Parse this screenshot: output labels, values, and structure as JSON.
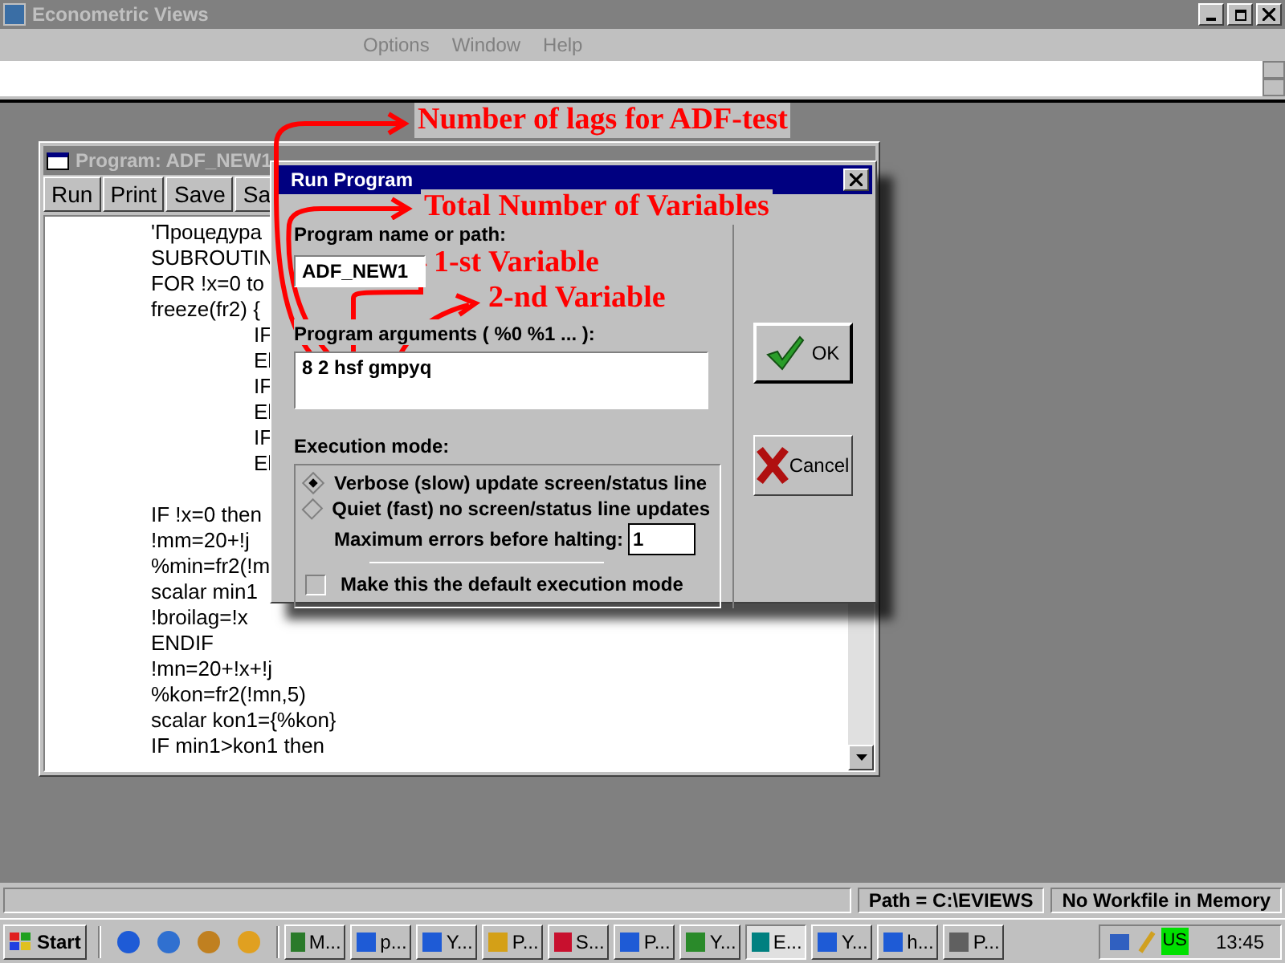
{
  "app_window": {
    "title": "Econometric Views",
    "menu": [
      "Options",
      "Window",
      "Help"
    ]
  },
  "program_window": {
    "title": "Program: ADF_NEW1",
    "toolbar": [
      "Run",
      "Print",
      "Save",
      "Sa"
    ],
    "lines": [
      {
        "text": "'Процедура",
        "kind": "top"
      },
      {
        "text": "SUBROUTIN",
        "kind": "top"
      },
      {
        "text": "FOR !x=0 to",
        "kind": "top"
      },
      {
        "text": "freeze(fr2) {",
        "kind": "top"
      },
      {
        "text": "IF",
        "kind": "inner"
      },
      {
        "text": "El",
        "kind": "inner"
      },
      {
        "text": "IF",
        "kind": "inner"
      },
      {
        "text": "El",
        "kind": "inner"
      },
      {
        "text": "IF",
        "kind": "inner"
      },
      {
        "text": "El",
        "kind": "inner"
      },
      {
        "kind": "blank"
      },
      {
        "text": "IF !x=0 then",
        "kind": "top"
      },
      {
        "text": "!mm=20+!j",
        "kind": "top"
      },
      {
        "text": "%min=fr2(!m",
        "kind": "top"
      },
      {
        "text": "scalar min1",
        "kind": "top"
      },
      {
        "text": "!broilag=!x",
        "kind": "top"
      },
      {
        "text": "ENDIF",
        "kind": "top"
      },
      {
        "text": "!mn=20+!x+!j",
        "kind": "top"
      },
      {
        "text": "%kon=fr2(!mn,5)",
        "kind": "top"
      },
      {
        "text": "scalar kon1={%kon}",
        "kind": "top"
      },
      {
        "text": "IF min1>kon1 then",
        "kind": "top"
      }
    ]
  },
  "dialog": {
    "title": "Run Program",
    "name_label": "Program name or path:",
    "name_value": "ADF_NEW1",
    "args_label": "Program arguments ( %0 %1 ... ):",
    "args_value": "8 2 hsf gmpyq",
    "ok": "OK",
    "cancel": "Cancel",
    "mode_label": "Execution mode:",
    "modes": [
      {
        "label": "Verbose (slow) update screen/status line",
        "selected": true
      },
      {
        "label": "Quiet (fast) no screen/status line updates",
        "selected": false
      }
    ],
    "max_errors_label": "Maximum errors before halting:",
    "max_errors_value": "1",
    "default_checkbox": {
      "label": "Make this the default execution mode",
      "checked": false
    }
  },
  "annotations": [
    {
      "text": "Number of lags for ADF-test"
    },
    {
      "text": "Total Number of Variables"
    },
    {
      "text": "1-st Variable"
    },
    {
      "text": "2-nd Variable"
    }
  ],
  "status_bar": [
    "Path = C:\\EVIEWS",
    "No Workfile in Memory"
  ],
  "taskbar": {
    "start": "Start",
    "tasks": [
      {
        "label": "M...",
        "selected": false
      },
      {
        "label": "p...",
        "selected": false
      },
      {
        "label": "Y...",
        "selected": false
      },
      {
        "label": "P...",
        "selected": false
      },
      {
        "label": "S...",
        "selected": false
      },
      {
        "label": "P...",
        "selected": false
      },
      {
        "label": "Y...",
        "selected": false
      },
      {
        "label": "E...",
        "selected": true
      },
      {
        "label": "Y...",
        "selected": false
      },
      {
        "label": "h...",
        "selected": false
      },
      {
        "label": "P...",
        "selected": false
      }
    ],
    "language": "US",
    "time": "13:45"
  }
}
